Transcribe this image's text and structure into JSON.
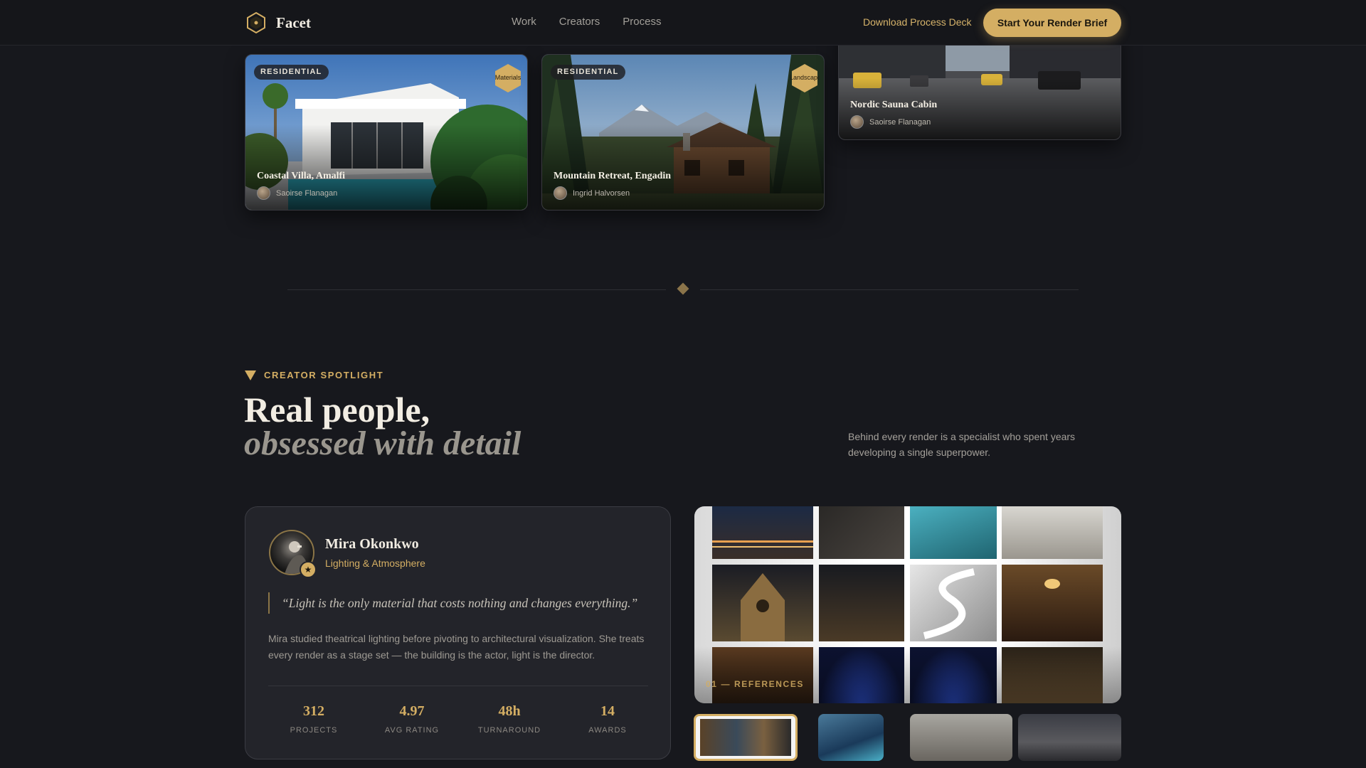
{
  "nav": {
    "brand": "Facet",
    "links": [
      "Work",
      "Creators",
      "Process"
    ],
    "download_label": "Download Process Deck",
    "cta_label": "Start Your Render Brief"
  },
  "projects": [
    {
      "tag": "RESIDENTIAL",
      "badge": "Materials",
      "title": "Coastal Villa, Amalfi",
      "author": "Saoirse Flanagan"
    },
    {
      "tag": "RESIDENTIAL",
      "badge": "Landscape",
      "title": "Mountain Retreat, Engadin",
      "author": "Ingrid Halvorsen"
    },
    {
      "title": "Nordic Sauna Cabin",
      "author": "Saoirse Flanagan"
    }
  ],
  "spotlight": {
    "eyebrow": "CREATOR SPOTLIGHT",
    "heading_line1": "Real people,",
    "heading_line2": "obsessed with detail",
    "intro": "Behind every render is a specialist who spent years developing a single superpower."
  },
  "creator": {
    "name": "Mira Okonkwo",
    "role": "Lighting & Atmosphere",
    "quote": "“Light is the only material that costs nothing and changes everything.”",
    "bio": "Mira studied theatrical lighting before pivoting to architectural visualization. She treats every render as a stage set — the building is the actor, light is the director.",
    "stats": [
      {
        "value": "312",
        "label": "PROJECTS"
      },
      {
        "value": "4.97",
        "label": "AVG RATING"
      },
      {
        "value": "48h",
        "label": "TURNAROUND"
      },
      {
        "value": "14",
        "label": "AWARDS"
      }
    ]
  },
  "gallery": {
    "caption": "01 — REFERENCES"
  },
  "colors": {
    "accent": "#d4ae63",
    "background": "#17181d",
    "card": "#23242a"
  }
}
